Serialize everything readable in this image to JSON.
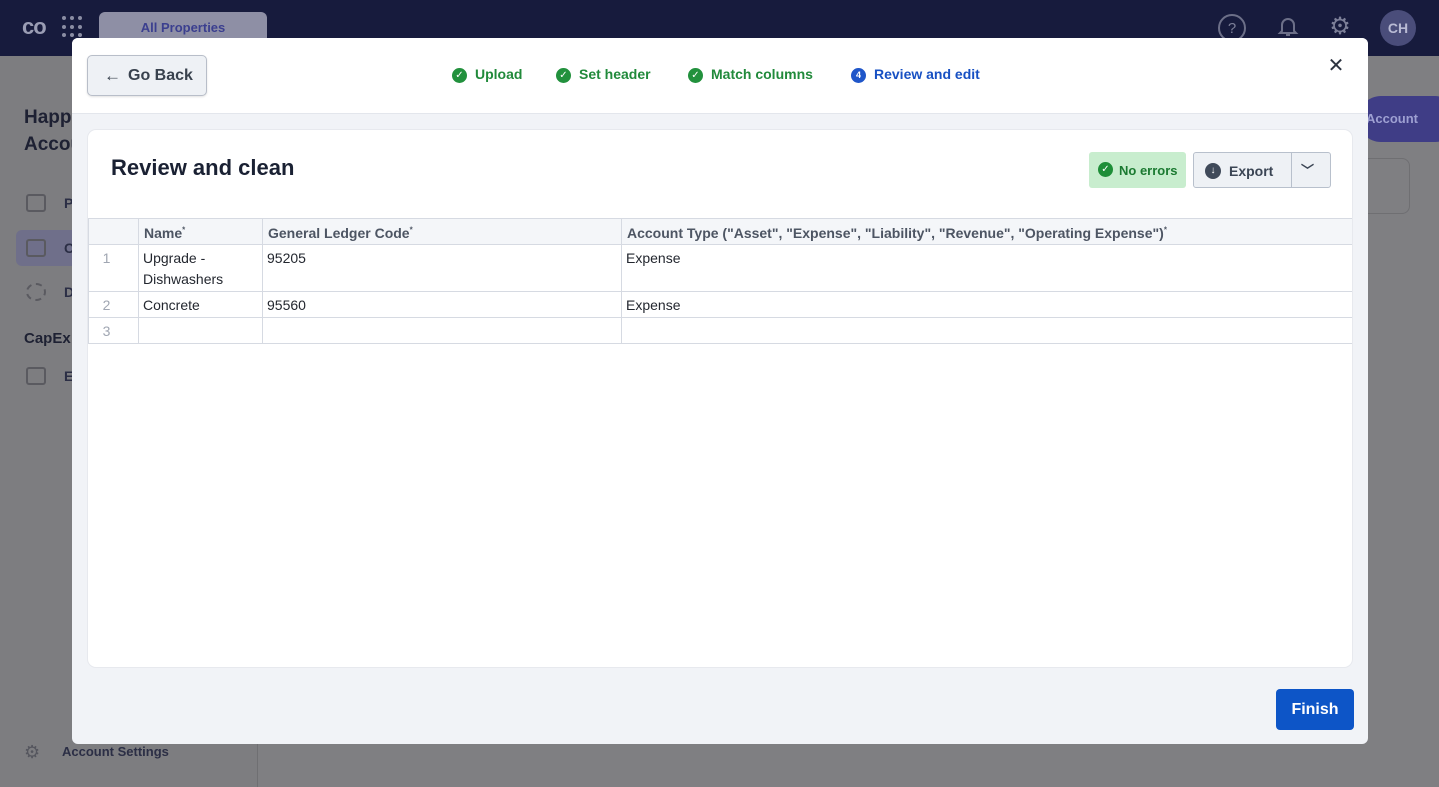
{
  "app": {
    "logo": "co",
    "property_tab": "All Properties",
    "avatar_initials": "CH",
    "help_glyph": "?"
  },
  "sidebar": {
    "title_line1": "Happ",
    "title_line2": "Accou",
    "items": [
      {
        "label": "P"
      },
      {
        "label": "C"
      },
      {
        "label": "D"
      }
    ],
    "section": "CapEx",
    "section_item": "E",
    "settings_label": "Account Settings"
  },
  "background": {
    "action_button": "Account"
  },
  "modal": {
    "go_back_label": "Go Back",
    "steps": [
      {
        "label": "Upload",
        "status": "done"
      },
      {
        "label": "Set header",
        "status": "done"
      },
      {
        "label": "Match columns",
        "status": "done"
      },
      {
        "label": "Review and edit",
        "status": "current",
        "number": "4"
      }
    ],
    "card_title": "Review and clean",
    "status_label": "No errors",
    "export_label": "Export",
    "table": {
      "columns": [
        "Name",
        "General Ledger Code",
        "Account Type (\"Asset\", \"Expense\", \"Liability\", \"Revenue\", \"Operating Expense\")"
      ],
      "required_marker": "*",
      "rows": [
        {
          "num": "1",
          "cells": [
            "Upgrade - Dishwashers",
            "95205",
            "Expense"
          ]
        },
        {
          "num": "2",
          "cells": [
            "Concrete",
            "95560",
            "Expense"
          ]
        },
        {
          "num": "3",
          "cells": [
            "",
            "",
            ""
          ]
        }
      ]
    },
    "finish_label": "Finish"
  },
  "colors": {
    "step_done": "#22913d",
    "step_current": "#1f56c9",
    "primary_button": "#0d55c7",
    "status_bg": "#c8edce"
  }
}
